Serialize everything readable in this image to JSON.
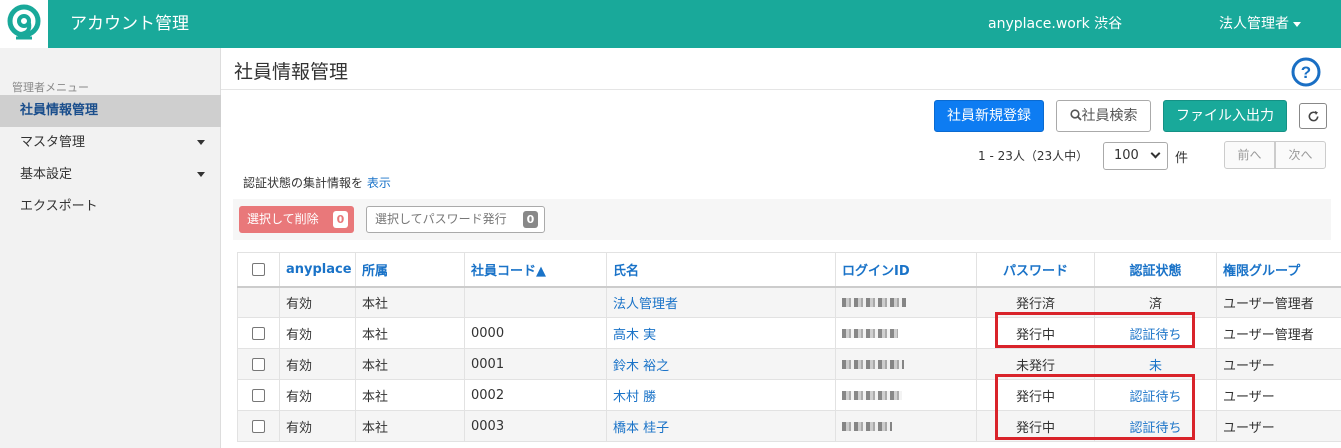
{
  "header": {
    "app_title": "アカウント管理",
    "office_name": "anyplace.work 渋谷",
    "user_menu_label": "法人管理者",
    "brand_color": "#19a99a"
  },
  "sidebar": {
    "heading": "管理者メニュー",
    "items": [
      {
        "label": "社員情報管理",
        "active": true
      },
      {
        "label": "マスタ管理",
        "has_submenu": true
      },
      {
        "label": "基本設定",
        "has_submenu": true
      },
      {
        "label": "エクスポート"
      }
    ]
  },
  "main": {
    "page_title": "社員情報管理",
    "help_icon": "question-circle-icon",
    "buttons": {
      "register": "社員新規登録",
      "search": "社員検索",
      "file_io": "ファイル入出力",
      "refresh_icon": "refresh-icon"
    },
    "pager": {
      "info": "1 - 23人（23人中）",
      "per_page": "100",
      "unit": "件",
      "prev": "前へ",
      "next": "次へ"
    },
    "summary": {
      "text": "認証状態の集計情報を",
      "link": "表示"
    },
    "actions": {
      "delete_label": "選択して削除",
      "delete_count": "0",
      "issue_password_label": "選択してパスワード発行",
      "issue_password_count": "0"
    },
    "table": {
      "headers": {
        "anyplace": "anyplace",
        "affiliation": "所属",
        "employee_code": "社員コード▲",
        "name": "氏名",
        "login_id": "ログインID",
        "password": "パスワード",
        "auth_status": "認証状態",
        "role_group": "権限グループ"
      },
      "rows": [
        {
          "anyplace": "有効",
          "affiliation": "本社",
          "code": "",
          "name": "法人管理者",
          "password": "発行済",
          "auth": "済",
          "auth_link": false,
          "group": "ユーザー管理者"
        },
        {
          "anyplace": "有効",
          "affiliation": "本社",
          "code": "0000",
          "name": "高木 実",
          "password": "発行中",
          "auth": "認証待ち",
          "auth_link": true,
          "group": "ユーザー管理者"
        },
        {
          "anyplace": "有効",
          "affiliation": "本社",
          "code": "0001",
          "name": "鈴木 裕之",
          "password": "未発行",
          "auth": "未",
          "auth_link": true,
          "group": "ユーザー"
        },
        {
          "anyplace": "有効",
          "affiliation": "本社",
          "code": "0002",
          "name": "木村 勝",
          "password": "発行中",
          "auth": "認証待ち",
          "auth_link": true,
          "group": "ユーザー"
        },
        {
          "anyplace": "有効",
          "affiliation": "本社",
          "code": "0003",
          "name": "橋本 桂子",
          "password": "発行中",
          "auth": "認証待ち",
          "auth_link": true,
          "group": "ユーザー"
        }
      ]
    }
  }
}
